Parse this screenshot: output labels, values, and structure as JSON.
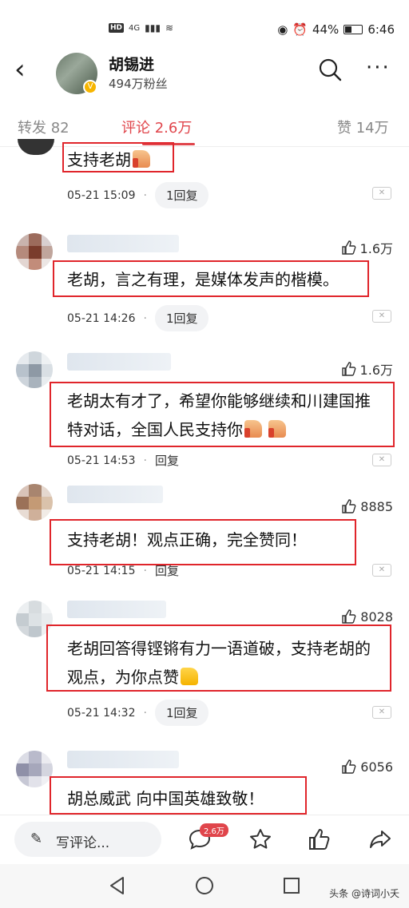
{
  "status_bar": {
    "network": "4G",
    "hd": "HD",
    "battery": "44%",
    "battery_level": 0.44,
    "time": "6:46"
  },
  "header": {
    "back_icon": "back-arrow-icon",
    "name": "胡锡进",
    "fans": "494万粉丝",
    "verified_icon": "v-badge-icon"
  },
  "tabs": [
    {
      "label": "转发 82"
    },
    {
      "label": "评论 2.6万",
      "active": true
    },
    {
      "label": "赞 14万"
    }
  ],
  "comments": [
    {
      "text": "支持老胡",
      "emoji": [
        "thumbs-up-emoji"
      ],
      "time": "05-21 15:09",
      "reply": "1回复",
      "likes": ""
    },
    {
      "text": "老胡，言之有理，是媒体发声的楷模。",
      "emoji": [],
      "time": "05-21 14:26",
      "reply": "1回复",
      "likes": "1.6万"
    },
    {
      "text": "老胡太有才了，希望你能够继续和川建国推特对话，全国人民支持你",
      "emoji": [
        "thumbs-up-emoji",
        "thumbs-up-emoji"
      ],
      "time": "05-21 14:53",
      "reply": "回复",
      "likes": "1.6万"
    },
    {
      "text": "支持老胡！观点正确，完全赞同！",
      "emoji": [],
      "time": "05-21 14:15",
      "reply": "回复",
      "likes": "8885"
    },
    {
      "text": "老胡回答得铿锵有力一语道破，支持老胡的观点，为你点赞",
      "emoji": [
        "thumbs-up-emoji"
      ],
      "time": "05-21 14:32",
      "reply": "1回复",
      "likes": "8028"
    },
    {
      "text": "胡总威武 向中国英雄致敬！",
      "emoji": [],
      "time": "",
      "reply": "",
      "likes": "6056"
    }
  ],
  "bottom_bar": {
    "write_label": "写评论...",
    "comment_badge": "2.6万"
  },
  "watermark": "头条 @诗词小夭",
  "colors": {
    "accent": "#e0454b",
    "highlight_box": "#e0252b"
  }
}
